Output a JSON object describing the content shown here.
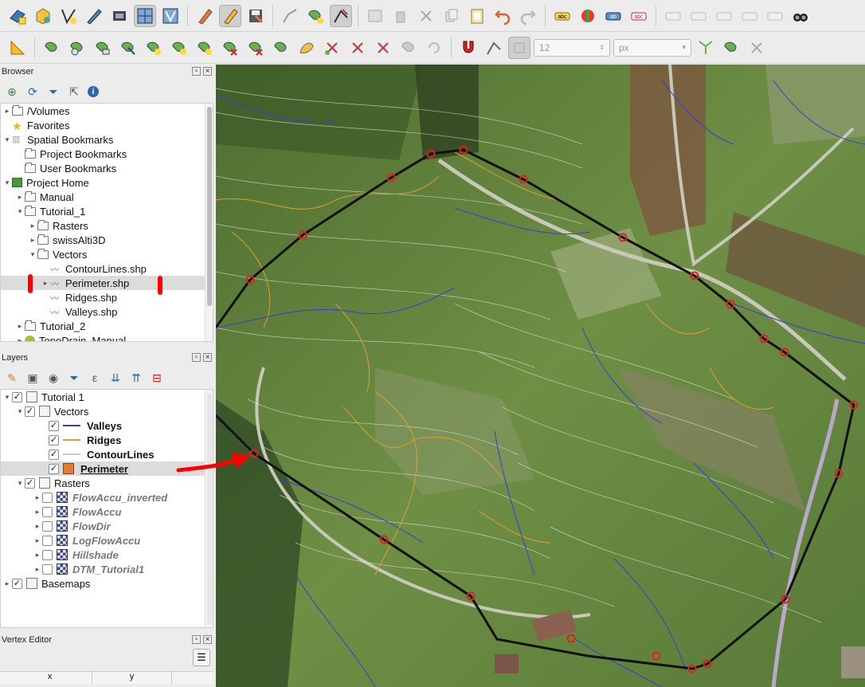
{
  "toolbar2": {
    "size_value": "12",
    "unit_value": "px"
  },
  "browser": {
    "title": "Browser",
    "items": [
      {
        "label": "/Volumes"
      },
      {
        "label": "Favorites"
      },
      {
        "label": "Spatial Bookmarks"
      },
      {
        "label": "Project Bookmarks"
      },
      {
        "label": "User Bookmarks"
      },
      {
        "label": "Project Home"
      },
      {
        "label": "Manual"
      },
      {
        "label": "Tutorial_1"
      },
      {
        "label": "Rasters"
      },
      {
        "label": "swissAlti3D"
      },
      {
        "label": "Vectors"
      },
      {
        "label": "ContourLines.shp"
      },
      {
        "label": "Perimeter.shp"
      },
      {
        "label": "Ridges.shp"
      },
      {
        "label": "Valleys.shp"
      },
      {
        "label": "Tutorial_2"
      },
      {
        "label": "TopoDrain_Manual"
      }
    ]
  },
  "layers": {
    "title": "Layers",
    "items": [
      {
        "label": "Tutorial 1"
      },
      {
        "label": "Vectors"
      },
      {
        "label": "Valleys",
        "color": "#3a3ad8"
      },
      {
        "label": "Ridges",
        "color": "#e0a030"
      },
      {
        "label": "ContourLines",
        "color": "#c8c8c8"
      },
      {
        "label": "Perimeter"
      },
      {
        "label": "Rasters"
      },
      {
        "label": "FlowAccu_inverted"
      },
      {
        "label": "FlowAccu"
      },
      {
        "label": "FlowDir"
      },
      {
        "label": "LogFlowAccu"
      },
      {
        "label": "Hillshade"
      },
      {
        "label": "DTM_Tutorial1"
      },
      {
        "label": "Basemaps"
      }
    ]
  },
  "vertex_editor": {
    "title": "Vertex Editor",
    "col_x": "x",
    "col_y": "y"
  },
  "colors": {
    "perimeter": "#111111",
    "vertex": "#e02020",
    "annotation": "#ff0000"
  }
}
